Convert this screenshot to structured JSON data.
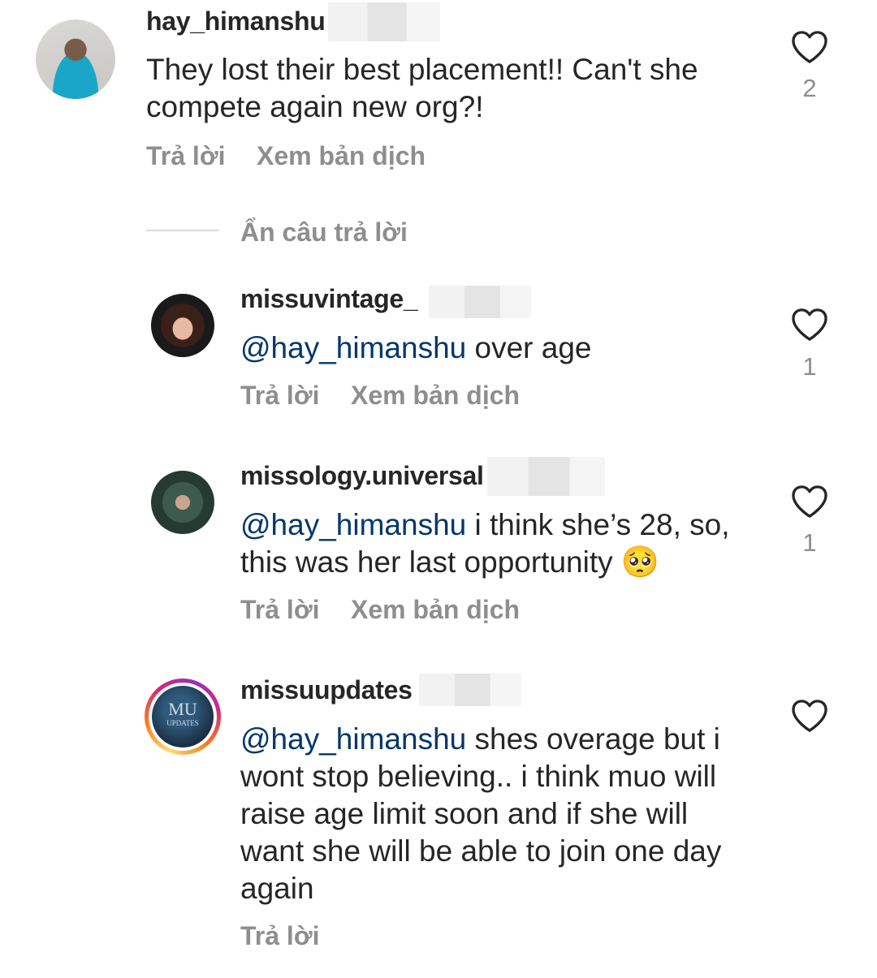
{
  "colors": {
    "text": "#262626",
    "secondary": "#8e8e8e",
    "mention": "#00376b",
    "divider": "#dbdbdb"
  },
  "icons": {
    "like": "heart-outline-icon"
  },
  "comment": {
    "username": "hay_himanshu",
    "lines": [
      "They lost their best placement!! Can't she",
      "compete again new org?!"
    ],
    "like_count": "2",
    "reply_label": "Trả lời",
    "translate_label": "Xem bản dịch"
  },
  "hide_replies_label": "Ẩn câu trả lời",
  "replies": [
    {
      "username": "missuvintage_",
      "mention": "@hay_himanshu",
      "lines": [
        " over age"
      ],
      "like_count": "1",
      "reply_label": "Trả lời",
      "translate_label": "Xem bản dịch"
    },
    {
      "username": "missology.universal",
      "mention": "@hay_himanshu",
      "lines": [
        " i think she’s 28, so,",
        "this was her last opportunity"
      ],
      "emoji": "🥺",
      "like_count": "1",
      "reply_label": "Trả lời",
      "translate_label": "Xem bản dịch"
    },
    {
      "username": "missuupdates",
      "avatar_text": [
        "MU",
        "UPDATES"
      ],
      "mention": "@hay_himanshu",
      "lines": [
        " shes overage but i",
        "wont stop believing.. i think muo will",
        "raise age limit soon and if she will",
        "want she will be able to join one day",
        "again"
      ],
      "like_count": "",
      "reply_label": "Trả lời"
    }
  ]
}
